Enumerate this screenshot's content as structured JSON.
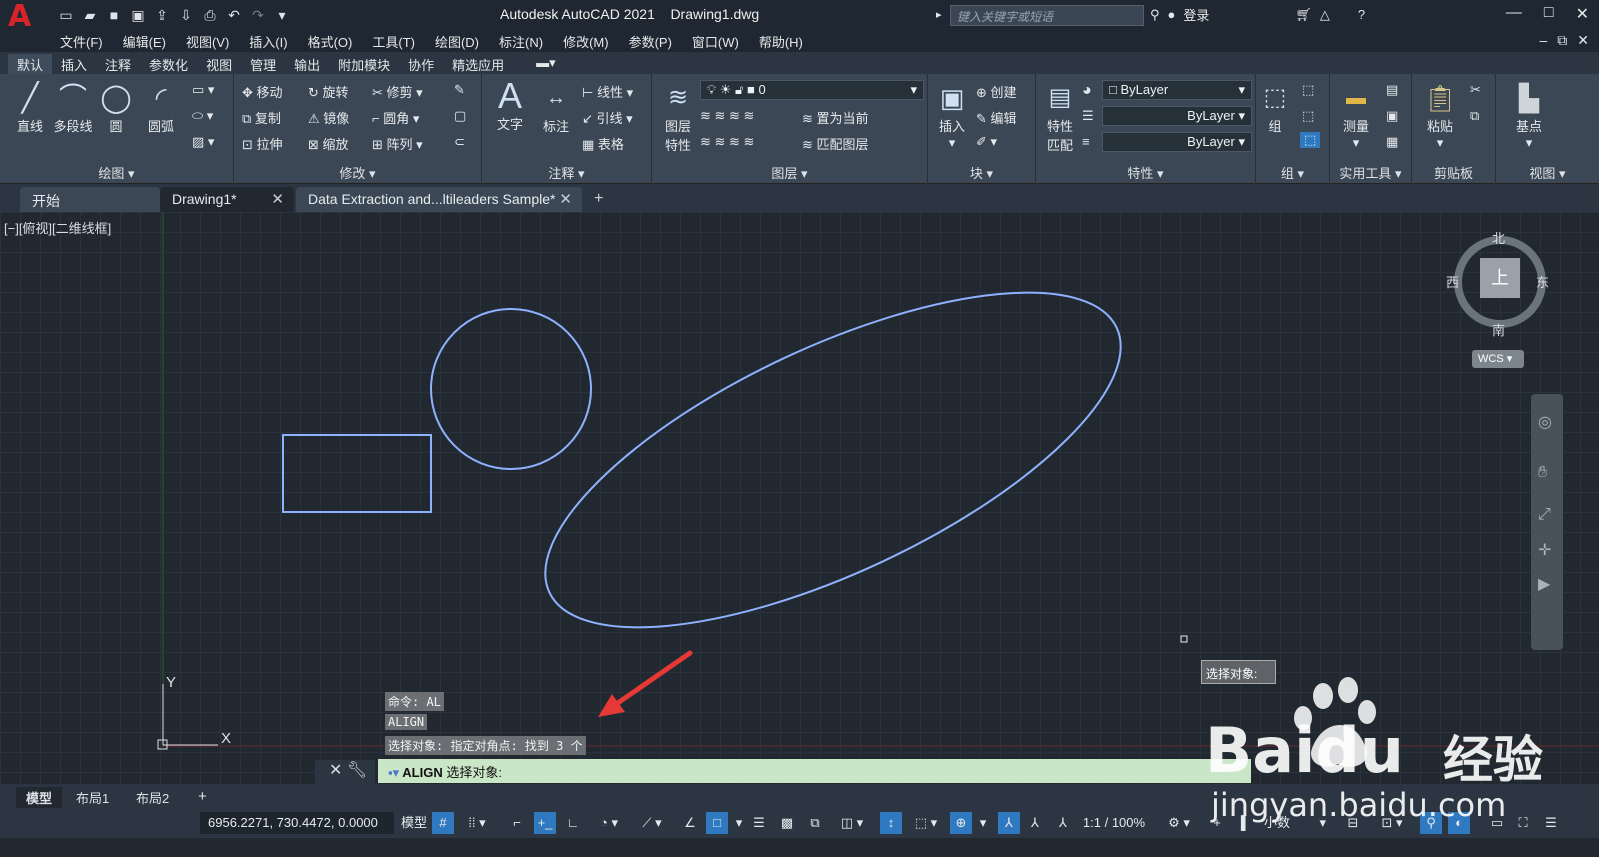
{
  "app": {
    "title": "Autodesk AutoCAD 2021    Drawing1.dwg",
    "search_placeholder": "键入关键字或短语",
    "login": "登录"
  },
  "menu": [
    "文件(F)",
    "编辑(E)",
    "视图(V)",
    "插入(I)",
    "格式(O)",
    "工具(T)",
    "绘图(D)",
    "标注(N)",
    "修改(M)",
    "参数(P)",
    "窗口(W)",
    "帮助(H)"
  ],
  "ribbon_tabs": [
    "默认",
    "插入",
    "注释",
    "参数化",
    "视图",
    "管理",
    "输出",
    "附加模块",
    "协作",
    "精选应用"
  ],
  "ribbon": {
    "draw": {
      "title": "绘图",
      "line": "直线",
      "polyline": "多段线",
      "circle": "圆",
      "arc": "圆弧"
    },
    "modify": {
      "title": "修改",
      "move": "移动",
      "rotate": "旋转",
      "trim": "修剪",
      "copy": "复制",
      "mirror": "镜像",
      "fillet": "圆角",
      "stretch": "拉伸",
      "scale": "缩放",
      "array": "阵列"
    },
    "annotation": {
      "title": "注释",
      "text": "文字",
      "dim": "标注",
      "linear": "线性",
      "leader": "引线",
      "table": "表格"
    },
    "layers": {
      "title": "图层",
      "props": "图层\n特性",
      "props_l1": "图层",
      "props_l2": "特性",
      "current_layer": "0",
      "set_current": "置为当前",
      "match": "匹配图层"
    },
    "block": {
      "title": "块",
      "insert": "插入",
      "create": "创建",
      "edit": "编辑"
    },
    "properties": {
      "title": "特性",
      "match_l1": "特性",
      "match_l2": "匹配",
      "color": "ByLayer",
      "linetype": "ByLayer",
      "lineweight": "ByLayer"
    },
    "groups": {
      "title": "组",
      "group": "组"
    },
    "utilities": {
      "title": "实用工具",
      "measure": "测量"
    },
    "clipboard": {
      "title": "剪贴板",
      "paste": "粘贴"
    },
    "view": {
      "title": "视图",
      "base": "基点"
    }
  },
  "doc_tabs": [
    {
      "label": "开始"
    },
    {
      "label": "Drawing1*"
    },
    {
      "label": "Data Extraction and...ltileaders Sample*"
    }
  ],
  "viewport": {
    "label": "[−][俯视][二维线框]",
    "viewcube": {
      "north": "北",
      "south": "南",
      "east": "东",
      "west": "西",
      "top": "上",
      "wcs": "WCS"
    },
    "ucs": {
      "x": "X",
      "y": "Y"
    },
    "tooltip": "选择对象:",
    "history": [
      "命令: AL",
      "ALIGN",
      "选择对象: 指定对角点: 找到 3 个"
    ]
  },
  "command_line": {
    "cmd": "ALIGN",
    "prompt": "选择对象:"
  },
  "layout_tabs": [
    "模型",
    "布局1",
    "布局2"
  ],
  "status": {
    "coords": "6956.2271, 730.4472, 0.0000",
    "model": "模型",
    "scale": "1:1 / 100%",
    "units": "小数"
  },
  "watermark": {
    "brand": "Baidu",
    "cn": "经验",
    "url": "jingyan.baidu.com"
  },
  "colors": {
    "accent": "#2f79c0",
    "shape": "#8ab0ff",
    "autocad_red": "#d8232a",
    "cmdline_bg": "#c9e6c6",
    "arrow": "#e53935"
  }
}
